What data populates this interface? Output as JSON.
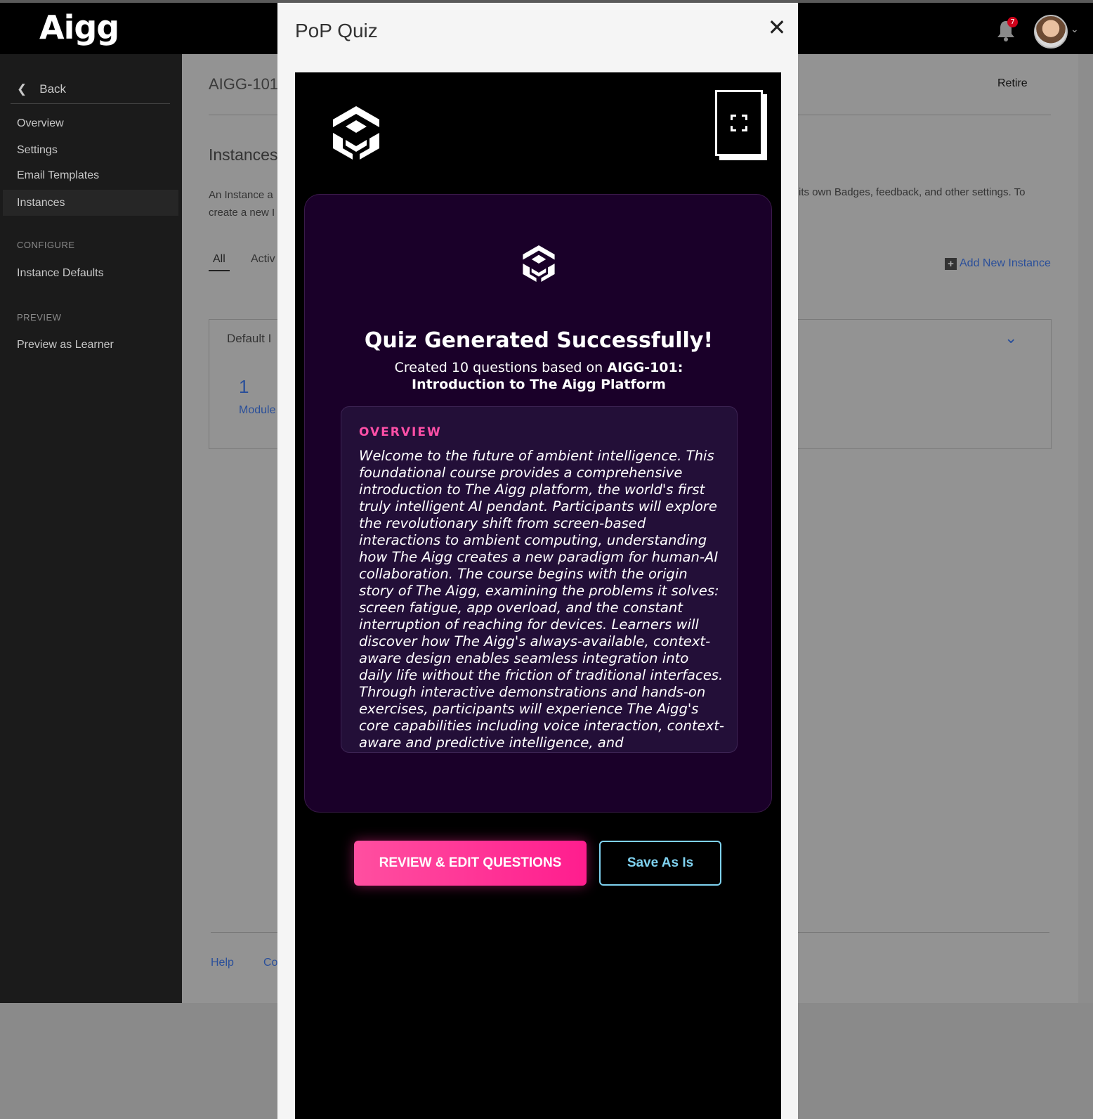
{
  "app": {
    "logo": "Aigg",
    "notifications_count": "7"
  },
  "sidebar": {
    "back_label": "Back",
    "items": [
      {
        "label": "Overview"
      },
      {
        "label": "Settings"
      },
      {
        "label": "Email Templates"
      },
      {
        "label": "Instances"
      }
    ],
    "configure_heading": "CONFIGURE",
    "configure_items": [
      {
        "label": "Instance Defaults"
      }
    ],
    "preview_heading": "PREVIEW",
    "preview_items": [
      {
        "label": "Preview as Learner"
      }
    ]
  },
  "main": {
    "breadcrumb": "AIGG-101",
    "retire_label": "Retire",
    "section_title": "Instances",
    "desc_left_line1": "An Instance a",
    "desc_left_line2": "create a new I",
    "desc_right": "its own Badges, feedback, and other settings. To",
    "tabs": [
      {
        "label": "All"
      },
      {
        "label": "Activ"
      }
    ],
    "add_instance_label": "Add New Instance",
    "card": {
      "title": "Default I",
      "count": "1",
      "count_label": "Module"
    },
    "footer": {
      "help": "Help",
      "co": "Co"
    }
  },
  "modal": {
    "title": "PoP Quiz",
    "close_glyph": "✕",
    "panel": {
      "title": "Quiz Generated Successfully!",
      "subtitle_prefix": "Created 10 questions based on",
      "course_name": "AIGG-101: Introduction to The Aigg Platform",
      "overview_heading": "OVERVIEW",
      "overview_text": "Welcome to the future of ambient intelligence. This foundational course provides a comprehensive introduction to The Aigg platform, the world's first truly intelligent AI pendant. Participants will explore the revolutionary shift from screen-based interactions to ambient computing, understanding how The Aigg creates a new paradigm for human-AI collaboration. The course begins with the origin story of The Aigg, examining the problems it solves: screen fatigue, app overload, and the constant interruption of reaching for devices. Learners will discover how The Aigg's always-available, context-aware design enables seamless integration into daily life without the friction of traditional interfaces. Through interactive demonstrations and hands-on exercises, participants will experience The Aigg's core capabilities including voice interaction, context-aware and predictive intelligence, and"
    },
    "buttons": {
      "review": "REVIEW & EDIT QUESTIONS",
      "save": "Save As Is"
    }
  },
  "colors": {
    "accent_pink": "#ff1d8e",
    "accent_cyan": "#7fd2f0",
    "panel_bg": "#1a0029",
    "link_blue": "#2a4f9a"
  }
}
